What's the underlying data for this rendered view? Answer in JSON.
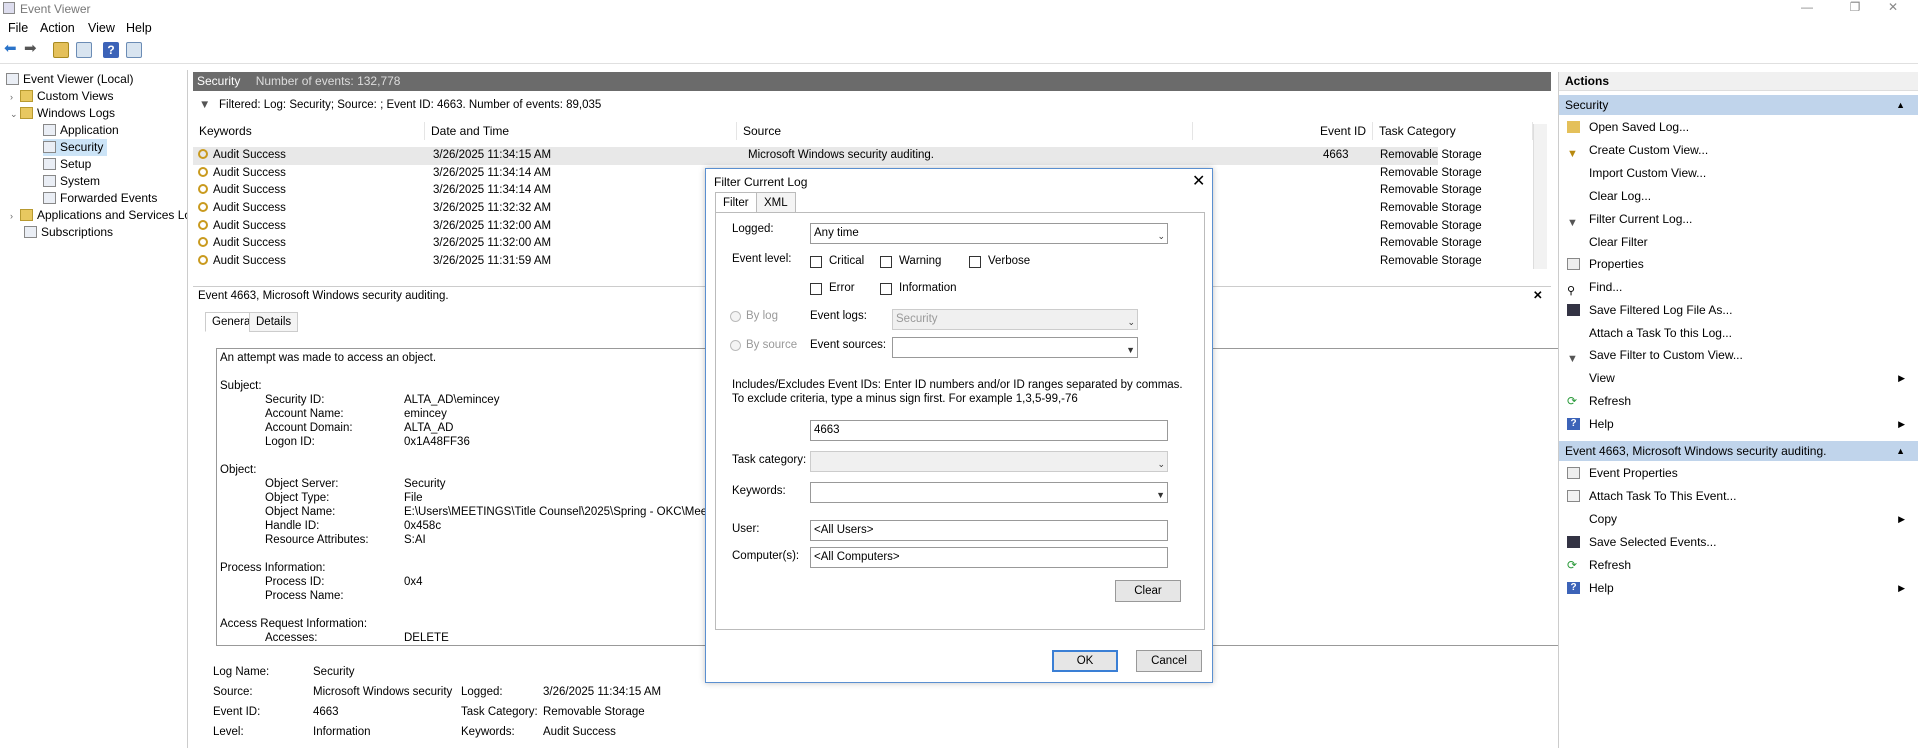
{
  "window": {
    "title": "Event Viewer"
  },
  "menu": [
    "File",
    "Action",
    "View",
    "Help"
  ],
  "tree": {
    "root": "Event Viewer (Local)",
    "items": [
      {
        "label": "Custom Views"
      },
      {
        "label": "Windows Logs"
      },
      {
        "label": "Application"
      },
      {
        "label": "Security"
      },
      {
        "label": "Setup"
      },
      {
        "label": "System"
      },
      {
        "label": "Forwarded Events"
      },
      {
        "label": "Applications and Services Lo"
      },
      {
        "label": "Subscriptions"
      }
    ]
  },
  "log": {
    "name": "Security",
    "count_text": "Number of events: 132,778",
    "filter_text": "Filtered: Log: Security; Source: ; Event ID: 4663. Number of events: 89,035",
    "columns": [
      "Keywords",
      "Date and Time",
      "Source",
      "Event ID",
      "Task Category"
    ],
    "rows": [
      {
        "keywords": "Audit Success",
        "date": "3/26/2025 11:34:15 AM",
        "source": "Microsoft Windows security auditing.",
        "event_id": "4663",
        "task": "Removable Storage"
      },
      {
        "keywords": "Audit Success",
        "date": "3/26/2025 11:34:14 AM",
        "source": "",
        "event_id": "",
        "task": "Removable Storage"
      },
      {
        "keywords": "Audit Success",
        "date": "3/26/2025 11:34:14 AM",
        "source": "",
        "event_id": "",
        "task": "Removable Storage"
      },
      {
        "keywords": "Audit Success",
        "date": "3/26/2025 11:32:32 AM",
        "source": "",
        "event_id": "",
        "task": "Removable Storage"
      },
      {
        "keywords": "Audit Success",
        "date": "3/26/2025 11:32:00 AM",
        "source": "",
        "event_id": "",
        "task": "Removable Storage"
      },
      {
        "keywords": "Audit Success",
        "date": "3/26/2025 11:32:00 AM",
        "source": "",
        "event_id": "",
        "task": "Removable Storage"
      },
      {
        "keywords": "Audit Success",
        "date": "3/26/2025 11:31:59 AM",
        "source": "",
        "event_id": "",
        "task": "Removable Storage"
      }
    ]
  },
  "details": {
    "header": "Event 4663, Microsoft Windows security auditing.",
    "tabs": [
      "General",
      "Details"
    ],
    "desc": {
      "intro": "An attempt was made to access an object.",
      "subject": "Subject:",
      "security_id_label": "Security ID:",
      "security_id": "ALTA_AD\\emincey",
      "account_name_label": "Account Name:",
      "account_name": "emincey",
      "account_domain_label": "Account Domain:",
      "account_domain": "ALTA_AD",
      "logon_id_label": "Logon ID:",
      "logon_id": "0x1A48FF36",
      "object": "Object:",
      "object_server_label": "Object Server:",
      "object_server": "Security",
      "object_type_label": "Object Type:",
      "object_type": "File",
      "object_name_label": "Object Name:",
      "object_name": "E:\\Users\\MEETINGS\\Title Counsel\\2025\\Spring - OKC\\Meeting",
      "handle_id_label": "Handle ID:",
      "handle_id": "0x458c",
      "resource_attr_label": "Resource Attributes:",
      "resource_attr": "S:AI",
      "process_info": "Process Information:",
      "process_id_label": "Process ID:",
      "process_id": "0x4",
      "process_name_label": "Process Name:",
      "access_req": "Access Request Information:",
      "accesses_label": "Accesses:",
      "accesses": "DELETE"
    },
    "fields": {
      "log_name_label": "Log Name:",
      "log_name": "Security",
      "source_label": "Source:",
      "source": "Microsoft Windows security",
      "logged_label": "Logged:",
      "logged": "3/26/2025 11:34:15 AM",
      "event_id_label": "Event ID:",
      "event_id": "4663",
      "task_category_label": "Task Category:",
      "task_category": "Removable Storage",
      "level_label": "Level:",
      "level": "Information",
      "keywords_label": "Keywords:",
      "keywords": "Audit Success"
    }
  },
  "actions": {
    "title": "Actions",
    "section1": "Security",
    "items1": [
      "Open Saved Log...",
      "Create Custom View...",
      "Import Custom View...",
      "Clear Log...",
      "Filter Current Log...",
      "Clear Filter",
      "Properties",
      "Find...",
      "Save Filtered Log File As...",
      "Attach a Task To this Log...",
      "Save Filter to Custom View...",
      "View",
      "Refresh",
      "Help"
    ],
    "section2": "Event 4663, Microsoft Windows security auditing.",
    "items2": [
      "Event Properties",
      "Attach Task To This Event...",
      "Copy",
      "Save Selected Events...",
      "Refresh",
      "Help"
    ]
  },
  "dialog": {
    "title": "Filter Current Log",
    "tabs": [
      "Filter",
      "XML"
    ],
    "logged_label": "Logged:",
    "logged_value": "Any time",
    "event_level_label": "Event level:",
    "levels": [
      "Critical",
      "Warning",
      "Verbose",
      "Error",
      "Information"
    ],
    "by_log": "By log",
    "by_source": "By source",
    "event_logs_label": "Event logs:",
    "event_logs_value": "Security",
    "event_sources_label": "Event sources:",
    "ids_help": "Includes/Excludes Event IDs: Enter ID numbers and/or ID ranges separated by commas. To exclude criteria, type a minus sign first. For example 1,3,5-99,-76",
    "ids_value": "4663",
    "task_category_label": "Task category:",
    "keywords_label": "Keywords:",
    "user_label": "User:",
    "user_value": "<All Users>",
    "computer_label": "Computer(s):",
    "computer_value": "<All Computers>",
    "clear_button": "Clear",
    "ok_button": "OK",
    "cancel_button": "Cancel"
  }
}
